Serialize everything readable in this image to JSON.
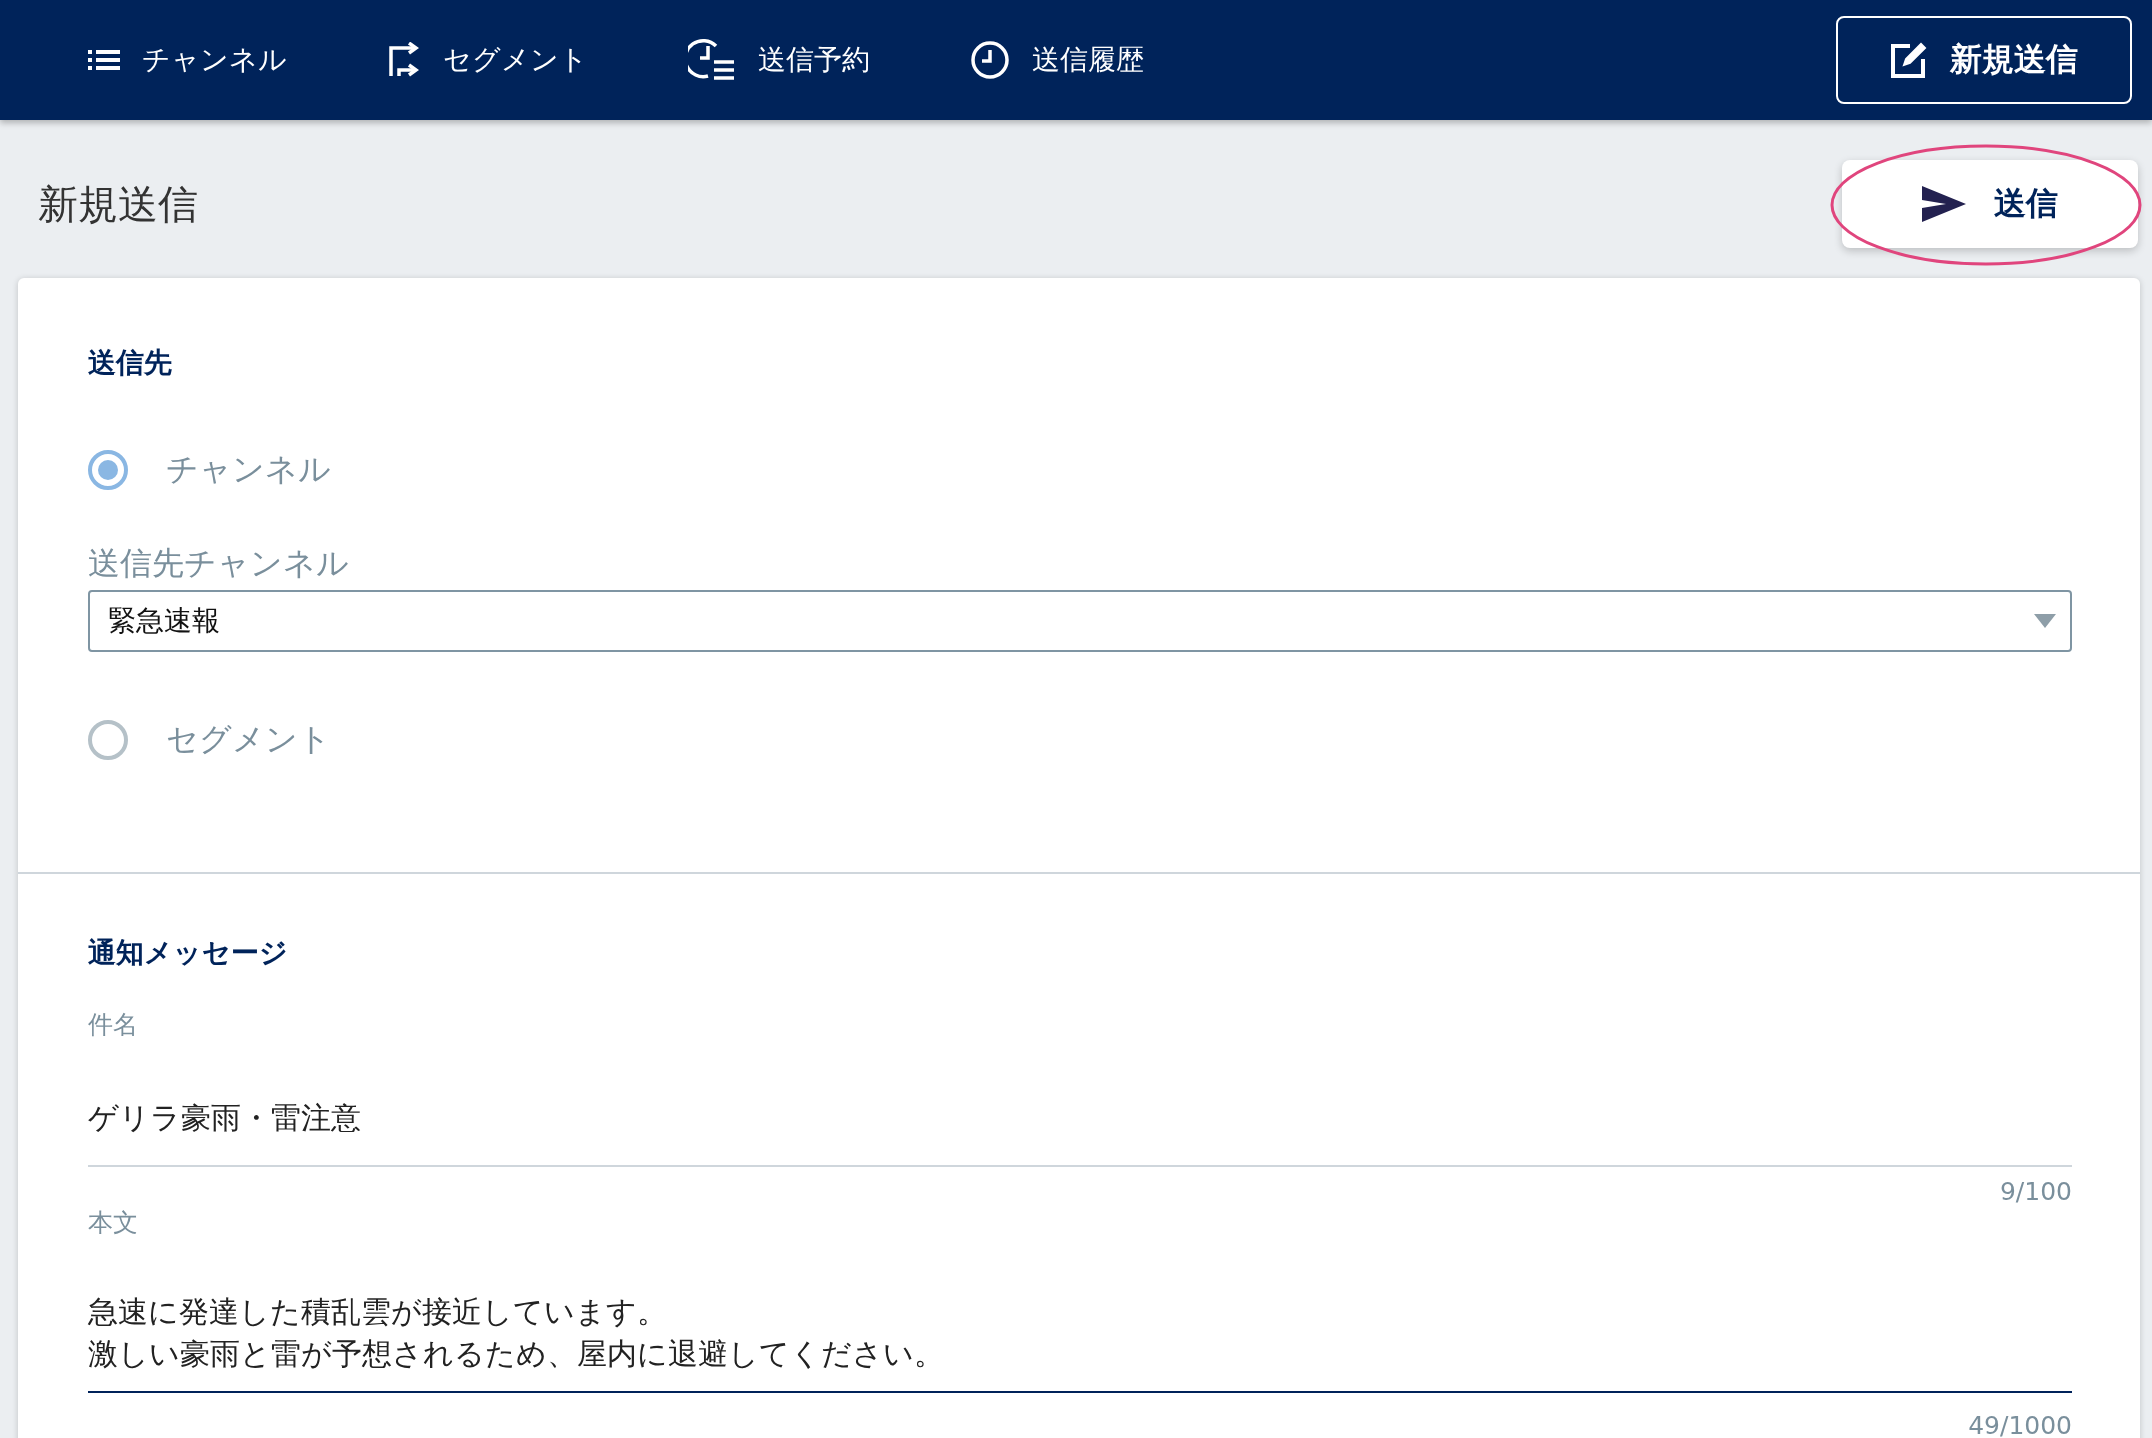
{
  "nav": {
    "items": [
      {
        "label": "チャンネル"
      },
      {
        "label": "セグメント"
      },
      {
        "label": "送信予約"
      },
      {
        "label": "送信履歴"
      }
    ],
    "new_button": "新規送信"
  },
  "page": {
    "title": "新規送信",
    "send_button": "送信",
    "send_highlighted": true
  },
  "recipient": {
    "heading": "送信先",
    "options": [
      {
        "label": "チャンネル",
        "selected": true
      },
      {
        "label": "セグメント",
        "selected": false
      }
    ],
    "channel_select": {
      "label": "送信先チャンネル",
      "value": "緊急速報"
    }
  },
  "message": {
    "heading": "通知メッセージ",
    "subject": {
      "label": "件名",
      "value": "ゲリラ豪雨・雷注意",
      "counter": "9/100",
      "focused": false
    },
    "body": {
      "label": "本文",
      "lines": [
        "急速に発達した積乱雲が接近しています。",
        "激しい豪雨と雷が予想されるため、屋内に退避してください。"
      ],
      "counter": "49/1000",
      "focused": true
    }
  }
}
